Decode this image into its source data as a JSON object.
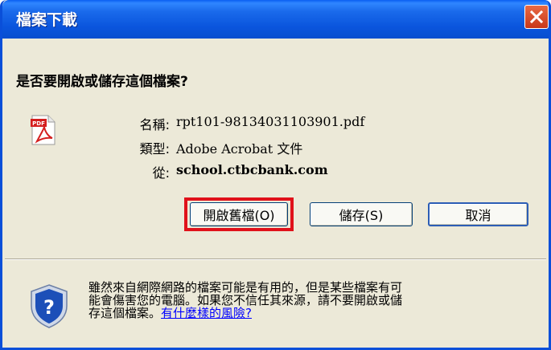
{
  "dialog": {
    "title": "檔案下載",
    "question": "是否要開啟或儲存這個檔案?"
  },
  "file": {
    "name_label": "名稱:",
    "name_value": "rpt101-98134031103901.pdf",
    "type_label": "類型:",
    "type_value": "Adobe Acrobat 文件",
    "from_label": "從:",
    "from_value": "school.ctbcbank.com",
    "icon": "pdf-file-icon",
    "icon_text": "PDF"
  },
  "buttons": {
    "open": "開啟舊檔(O)",
    "save": "儲存(S)",
    "cancel": "取消"
  },
  "warning": {
    "line1": "雖然來自網際網路的檔案可能是有用的，但是某些檔案有可",
    "line2": "能會傷害您的電腦。如果您不信任其來源，請不要開啟或儲",
    "line3_prefix": "存這個檔案。",
    "link": "有什麼樣的風險?"
  },
  "colors": {
    "titlebar": "#0a55dd",
    "highlight": "#e0111a",
    "link": "#0000ff"
  }
}
